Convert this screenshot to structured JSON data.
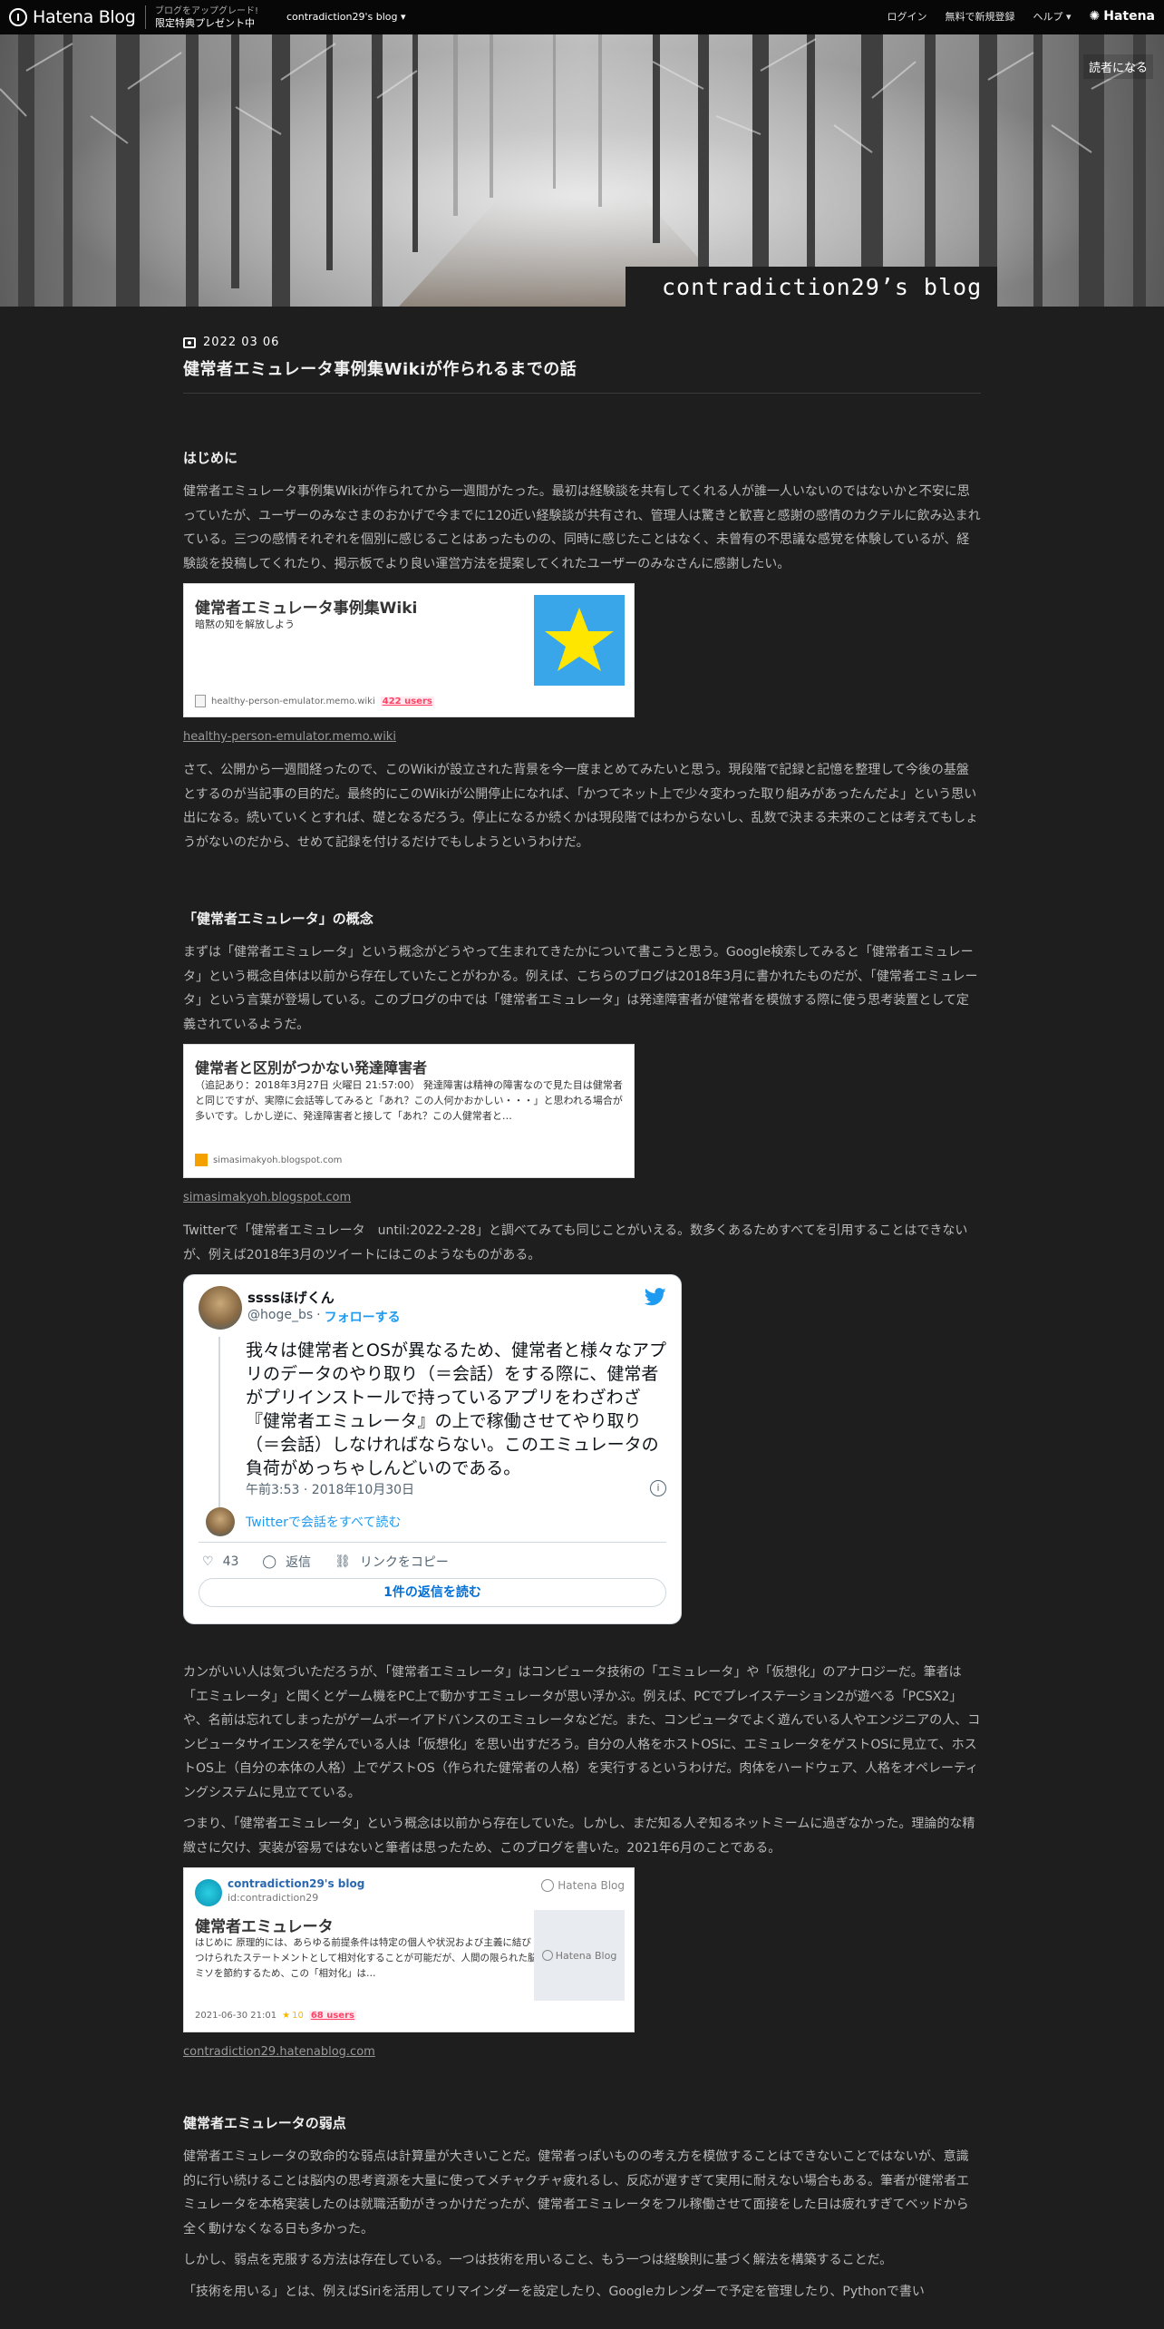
{
  "topbar": {
    "logo": "Hatena Blog",
    "promo_line1": "ブログをアップグレード!",
    "promo_line2": "限定特典プレゼント中",
    "blog_menu": "contradiction29's blog ▾",
    "login": "ログイン",
    "signup": "無料で新規登録",
    "help": "ヘルプ ▾",
    "hatena": "Hatena"
  },
  "header": {
    "reader_button": "読者になる",
    "blog_title": "contradiction29’s blog"
  },
  "article": {
    "date": "2022 03 06",
    "title": "健常者エミュレータ事例集Wikiが作られるまでの話",
    "h_intro": "はじめに",
    "p_intro": "健常者エミュレータ事例集Wikiが作られてから一週間がたった。最初は経験談を共有してくれる人が誰一人いないのではないかと不安に思っていたが、ユーザーのみなさまのおかげで今までに120近い経験談が共有され、管理人は驚きと歓喜と感謝の感情のカクテルに飲み込まれている。三つの感情それぞれを個別に感じることはあったものの、同時に感じたことはなく、未曾有の不思議な感覚を体験しているが、経験談を投稿してくれたり、掲示板でより良い運営方法を提案してくれたユーザーのみなさんに感謝したい。",
    "card1": {
      "title": "健常者エミュレータ事例集Wiki",
      "desc": "暗黙の知を解放しよう",
      "domain": "healthy-person-emulator.memo.wiki",
      "users": "422 users"
    },
    "link1": "healthy-person-emulator.memo.wiki",
    "p_intro2": "さて、公開から一週間経ったので、このWikiが設立された背景を今一度まとめてみたいと思う。現段階で記録と記憶を整理して今後の基盤とするのが当記事の目的だ。最終的にこのWikiが公開停止になれば、「かつてネット上で少々変わった取り組みがあったんだよ」という思い出になる。続いていくとすれば、礎となるだろう。停止になるか続くかは現段階ではわからないし、乱数で決まる未来のことは考えてもしょうがないのだから、せめて記録を付けるだけでもしようというわけだ。",
    "h_concept": "「健常者エミュレータ」の概念",
    "p_concept": "まずは「健常者エミュレータ」という概念がどうやって生まれてきたかについて書こうと思う。Google検索してみると「健常者エミュレータ」という概念自体は以前から存在していたことがわかる。例えば、こちらのブログは2018年3月に書かれたものだが、「健常者エミュレータ」という言葉が登場している。このブログの中では「健常者エミュレータ」は発達障害者が健常者を模倣する際に使う思考装置として定義されているようだ。",
    "card2": {
      "title": "健常者と区別がつかない発達障害者",
      "desc": "（追記あり：2018年3月27日 火曜日 21:57:00） 発達障害は精神の障害なので見た目は健常者と同じですが、実際に会話等してみると「あれ？この人何かおかしい・・・」と思われる場合が多いです。しかし逆に、発達障害者と接して「あれ？この人健常者と…",
      "domain": "simasimakyoh.blogspot.com"
    },
    "link2": "simasimakyoh.blogspot.com",
    "p_twitter": "Twitterで「健常者エミュレータ　until:2022-2-28」と調べてみても同じことがいえる。数多くあるためすべてを引用することはできないが、例えば2018年3月のツイートにはこのようなものがある。",
    "tweet": {
      "name": "ssssほげくん",
      "handle": "@hoge_bs",
      "dot": "·",
      "follow": "フォローする",
      "text": "我々は健常者とOSが異なるため、健常者と様々なアプリのデータのやり取り（＝会話）をする際に、健常者がプリインストールで持っているアプリをわざわざ『健常者エミュレータ』の上で稼働させてやり取り（＝会話）しなければならない。このエミュレータの負荷がめっちゃしんどいのである。",
      "time": "午前3:53 · 2018年10月30日",
      "thread": "Twitterで会話をすべて読む",
      "likes": "43",
      "reply": "返信",
      "copy": "リンクをコピー",
      "read_replies": "1件の返信を読む"
    },
    "p_analogy": "カンがいい人は気づいただろうが、「健常者エミュレータ」はコンピュータ技術の「エミュレータ」や「仮想化」のアナロジーだ。筆者は「エミュレータ」と聞くとゲーム機をPC上で動かすエミュレータが思い浮かぶ。例えば、PCでプレイステーション2が遊べる「PCSX2」や、名前は忘れてしまったがゲームボーイアドバンスのエミュレータなどだ。また、コンピュータでよく遊んでいる人やエンジニアの人、コンピュータサイエンスを学んでいる人は「仮想化」を思い出すだろう。自分の人格をホストOSに、エミュレータをゲストOSに見立て、ホストOS上（自分の本体の人格）上でゲストOS（作られた健常者の人格）を実行するというわけだ。肉体をハードウェア、人格をオペレーティングシステムに見立てている。",
    "p_meme": "つまり、「健常者エミュレータ」という概念は以前から存在していた。しかし、まだ知る人ぞ知るネットミームに過ぎなかった。理論的な精緻さに欠け、実装が容易ではないと筆者は思ったため、このブログを書いた。2021年6月のことである。",
    "card3": {
      "blog": "contradiction29's blog",
      "id": "id:contradiction29",
      "brand": "Hatena Blog",
      "title": "健常者エミュレータ",
      "desc": "はじめに 原理的には、あらゆる前提条件は特定の個人や状況および主義に結びつけられたステートメントとして相対化することが可能だが、人間の限られた脳ミソを節約するため、この「相対化」は…",
      "date": "2021-06-30 21:01",
      "stars": "10",
      "users": "68 users"
    },
    "link3": "contradiction29.hatenablog.com",
    "h_weak": "健常者エミュレータの弱点",
    "p_weak": "健常者エミュレータの致命的な弱点は計算量が大きいことだ。健常者っぽいものの考え方を模倣することはできないことではないが、意識的に行い続けることは脳内の思考資源を大量に使ってメチャクチャ疲れるし、反応が遅すぎて実用に耐えない場合もある。筆者が健常者エミュレータを本格実装したのは就職活動がきっかけだったが、健常者エミュレータをフル稼働させて面接をした日は疲れすぎてベッドから全く動けなくなる日も多かった。",
    "p_solve": "しかし、弱点を克服する方法は存在している。一つは技術を用いること、もう一つは経験則に基づく解法を構築することだ。",
    "p_tech": "「技術を用いる」とは、例えばSiriを活用してリマインダーを設定したり、Googleカレンダーで予定を管理したり、Pythonで書い"
  },
  "colors": {
    "background": "#1e1e1e",
    "text": "#b9b9b9",
    "heading": "#f0f0f0",
    "twitter_blue": "#1d9bf0",
    "users_red": "#ff4166",
    "star": "#f6b900"
  }
}
